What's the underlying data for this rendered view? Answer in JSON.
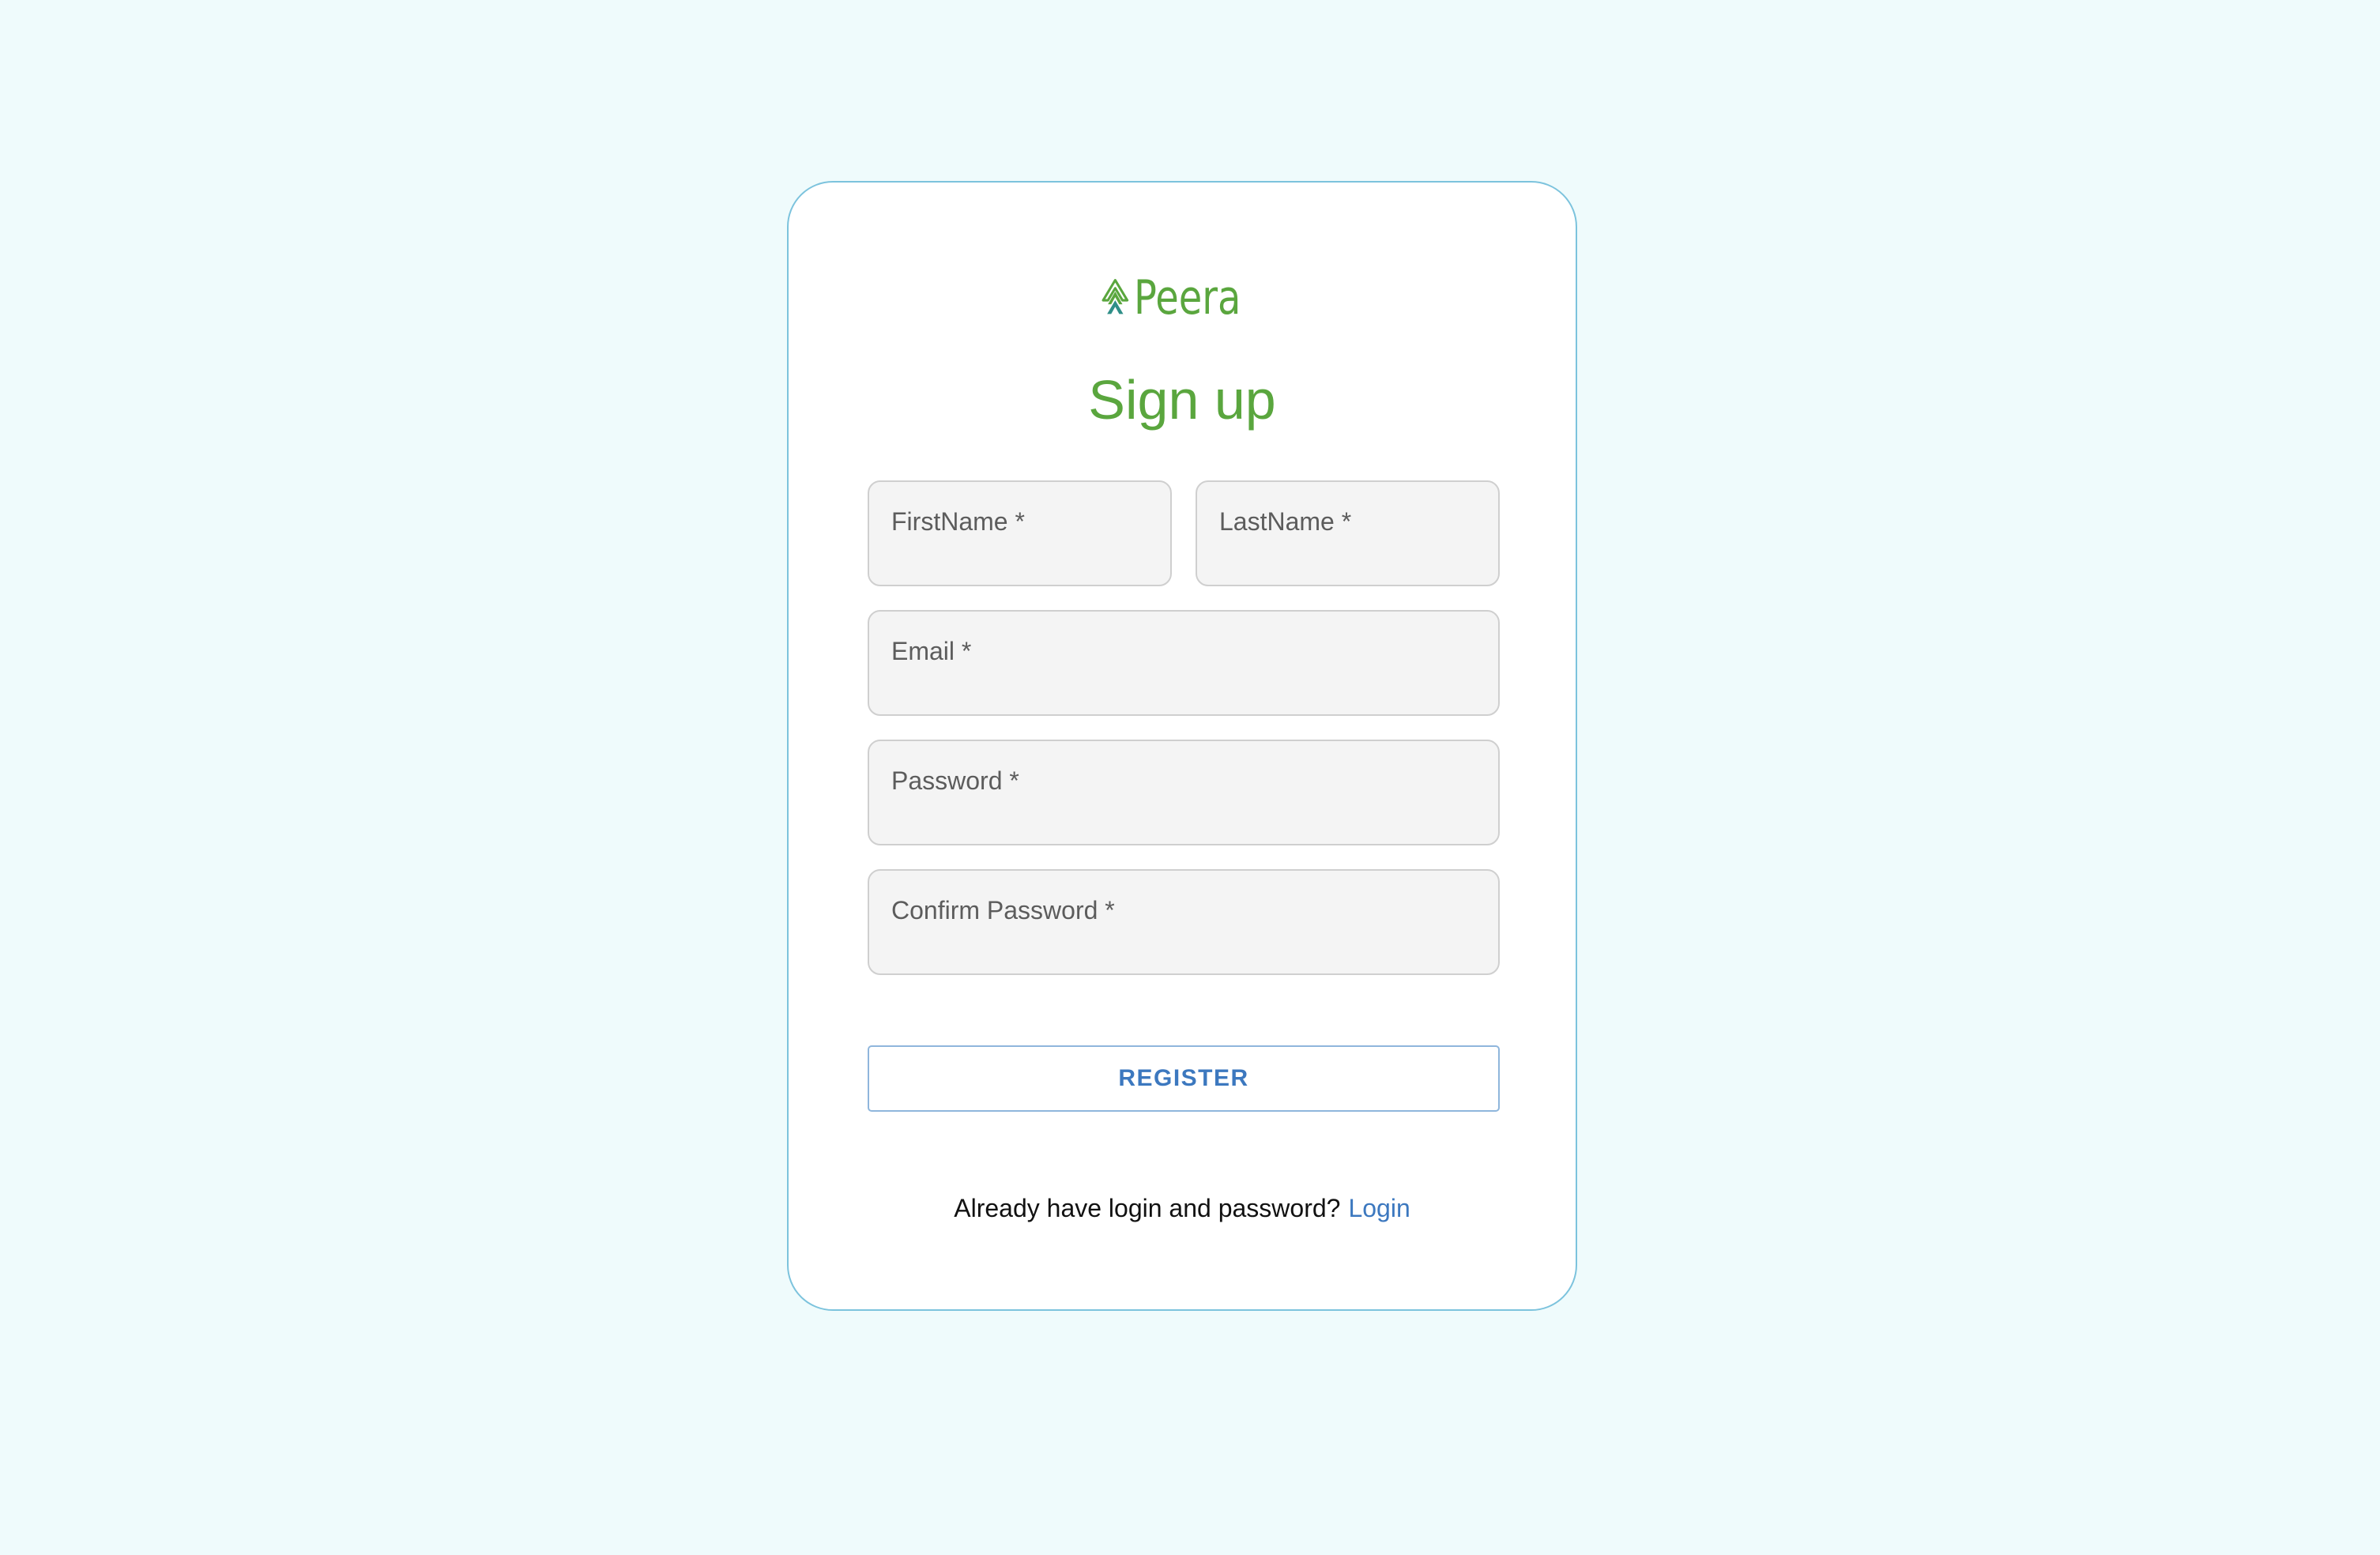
{
  "brand": {
    "name": "Peera",
    "icon": "peera-tree-logo-icon",
    "color": "#5aa63e",
    "icon_accent_color": "#2f8f88"
  },
  "form": {
    "title": "Sign up",
    "fields": {
      "first_name": {
        "label": "FirstName *",
        "value": ""
      },
      "last_name": {
        "label": "LastName *",
        "value": ""
      },
      "email": {
        "label": "Email *",
        "value": ""
      },
      "password": {
        "label": "Password *",
        "value": ""
      },
      "confirm_password": {
        "label": "Confirm Password *",
        "value": ""
      }
    },
    "register_label": "REGISTER"
  },
  "footer": {
    "prompt": "Already have login and password?",
    "login_label": "Login"
  },
  "colors": {
    "background": "#effbfc",
    "card_border": "#7cc3dd",
    "link": "#3c78bf",
    "field_background": "#f4f4f4"
  }
}
